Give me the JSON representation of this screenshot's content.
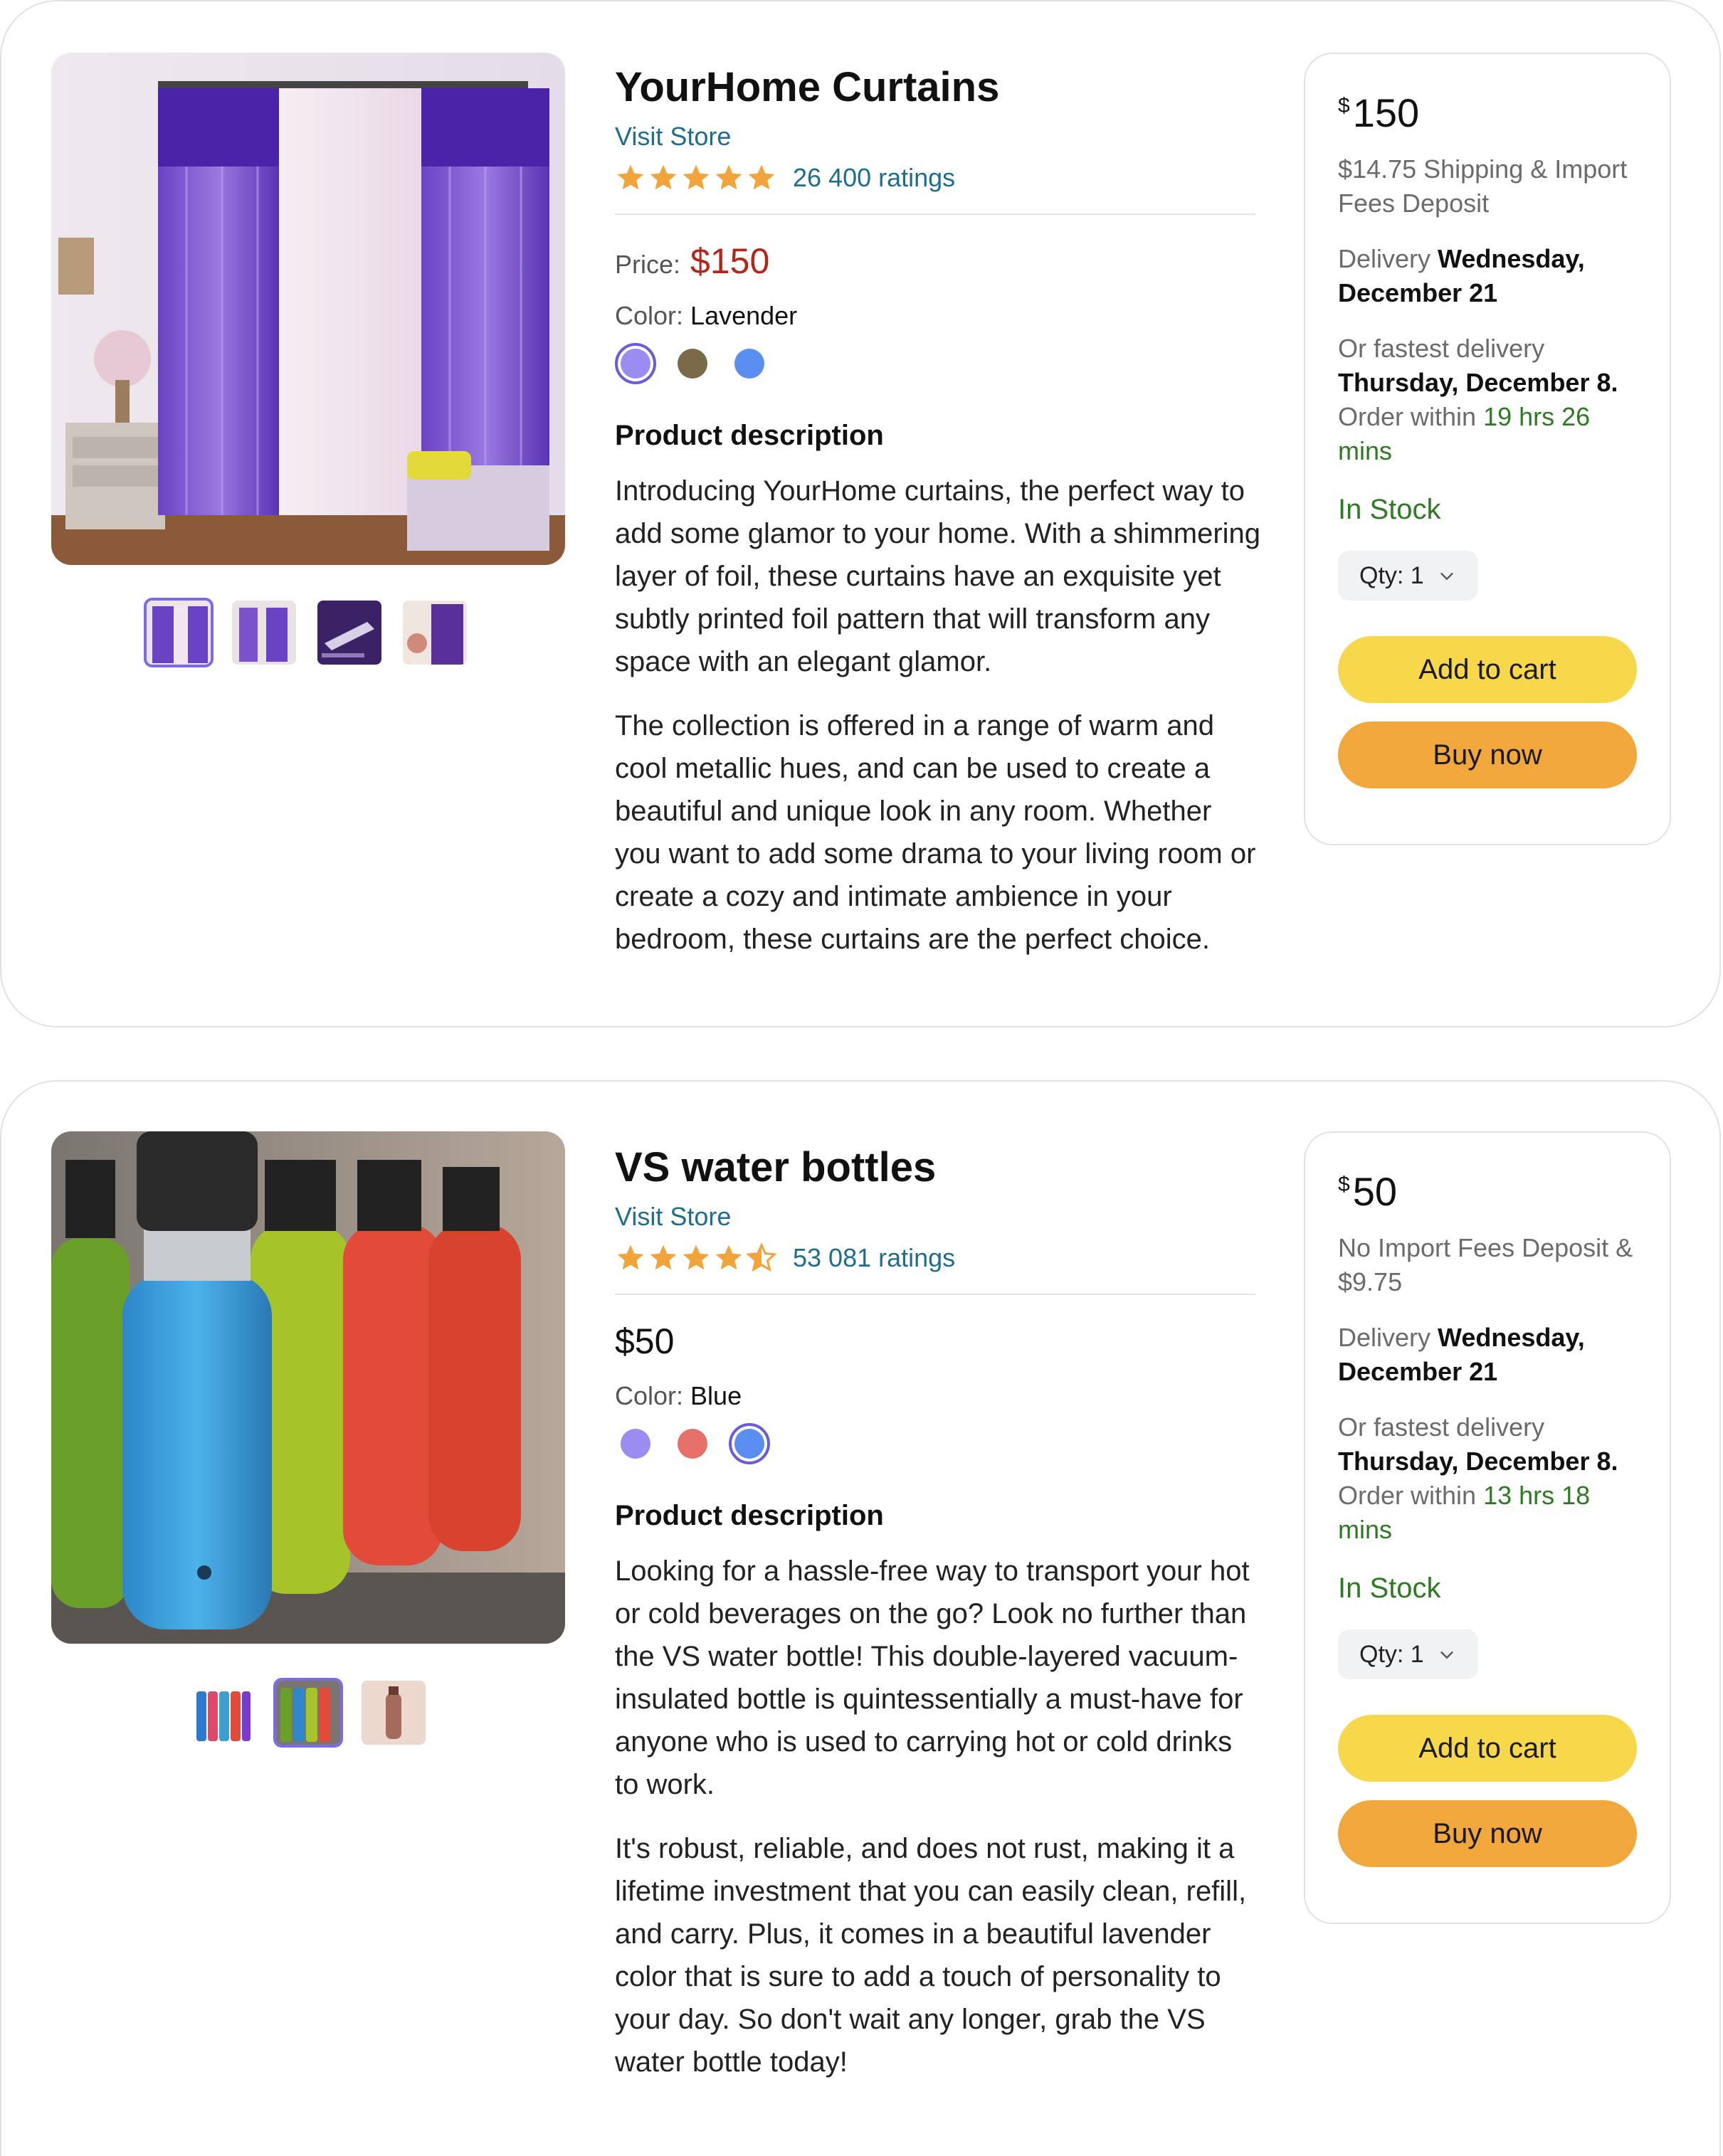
{
  "products": [
    {
      "title": "YourHome Curtains",
      "visit_store": "Visit Store",
      "ratings": "26 400 ratings",
      "stars": 5,
      "price_label": "Price:",
      "price": "$150",
      "color_label": "Color:",
      "color_value": "Lavender",
      "swatches": [
        "#9b8cf2",
        "#7a6a4a",
        "#5a8ef0"
      ],
      "selected_swatch": 0,
      "thumb_count": 4,
      "selected_thumb": 0,
      "desc_heading": "Product description",
      "desc": [
        "Introducing YourHome curtains, the perfect way to add some glamor to your home. With a shimmering layer of foil, these curtains have an exquisite yet subtly printed foil pattern that will transform any space with an elegant glamor.",
        "The collection is offered in a range of warm and cool metallic hues, and can be used to create a beautiful and unique look in any room. Whether you want to add some drama to your living room or create a cozy and intimate ambience in your bedroom, these curtains are the perfect choice."
      ],
      "buy_box": {
        "currency": "$",
        "amount": "150",
        "shipping": "$14.75 Shipping & Import Fees Deposit",
        "delivery_label": "Delivery",
        "delivery_date": "Wednesday, December 21",
        "fast_label": "Or fastest delivery",
        "fast_date": "Thursday, December 8.",
        "order_within": "Order within",
        "countdown": "19 hrs 26 mins",
        "stock": "In Stock",
        "qty": "Qty: 1",
        "add_to_cart": "Add to cart",
        "buy_now": "Buy now"
      }
    },
    {
      "title": "VS water bottles",
      "visit_store": "Visit Store",
      "ratings": "53 081 ratings",
      "stars": 4.5,
      "price": "$50",
      "color_label": "Color:",
      "color_value": "Blue",
      "swatches": [
        "#9b8cf2",
        "#e8706a",
        "#5a8ef0"
      ],
      "selected_swatch": 2,
      "thumb_count": 3,
      "selected_thumb": 1,
      "desc_heading": "Product description",
      "desc": [
        "Looking for a hassle-free way to transport your hot or cold beverages on the go? Look no further than the VS water bottle! This double-layered vacuum-insulated bottle is quintessentially a must-have for anyone who is used to carrying hot or cold drinks to work.",
        "It's robust, reliable, and does not rust, making it a lifetime investment that you can easily clean, refill, and carry. Plus, it comes in a beautiful lavender color that is sure to add a touch of personality to your day. So don't wait any longer, grab the VS water bottle today!"
      ],
      "buy_box": {
        "currency": "$",
        "amount": "50",
        "shipping": "No Import Fees Deposit & $9.75",
        "delivery_label": "Delivery",
        "delivery_date": "Wednesday, December 21",
        "fast_label": "Or fastest delivery",
        "fast_date": "Thursday, December 8.",
        "order_within": "Order within",
        "countdown": "13 hrs 18 mins",
        "stock": "In Stock",
        "qty": "Qty: 1",
        "add_to_cart": "Add to cart",
        "buy_now": "Buy now"
      }
    }
  ],
  "colors": {
    "link": "#1f6d8c",
    "price_red": "#b4261a",
    "stock_green": "#2d7a22",
    "star": "#f2a33a",
    "add_to_cart_bg": "#f7d84a",
    "buy_now_bg": "#f2a73d",
    "selected_border": "#7b6be6"
  }
}
